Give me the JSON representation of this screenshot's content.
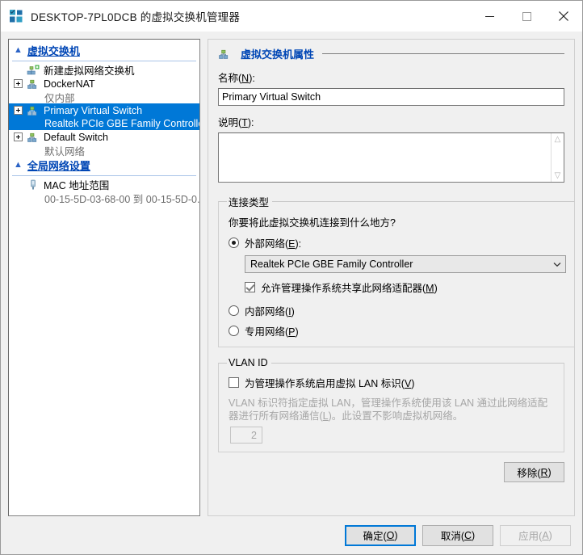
{
  "window": {
    "title": "DESKTOP-7PL0DCB 的虚拟交换机管理器",
    "app_icon": "hyperv-icon",
    "minimize_label": "—",
    "maximize_label": "□",
    "close_label": "✕"
  },
  "tree": {
    "sections": [
      {
        "label": "虚拟交换机",
        "items": [
          {
            "label": "新建虚拟网络交换机",
            "sub": "",
            "icon": "new-virtual-switch-icon",
            "expander": false,
            "selected": false
          },
          {
            "label": "DockerNAT",
            "sub": "仅内部",
            "icon": "virtual-switch-icon",
            "expander": true,
            "selected": false
          },
          {
            "label": "Primary Virtual Switch",
            "sub": "Realtek PCIe GBE Family Controller",
            "icon": "virtual-switch-icon",
            "expander": true,
            "selected": true
          },
          {
            "label": "Default Switch",
            "sub": "默认网络",
            "icon": "virtual-switch-icon",
            "expander": true,
            "selected": false
          }
        ]
      },
      {
        "label": "全局网络设置",
        "items": [
          {
            "label": "MAC 地址范围",
            "sub": "00-15-5D-03-68-00 到 00-15-5D-0...",
            "icon": "mac-address-icon",
            "expander": false,
            "selected": false
          }
        ]
      }
    ]
  },
  "detail": {
    "header": "虚拟交换机属性",
    "header_icon": "virtual-switch-icon",
    "name_label": "名称(N):",
    "name_value": "Primary Virtual Switch",
    "description_label": "说明(T):",
    "description_value": "",
    "connection": {
      "legend": "连接类型",
      "hint": "你要将此虚拟交换机连接到什么地方?",
      "external_label": "外部网络(E):",
      "external_selected": true,
      "adapter_value": "Realtek PCIe GBE Family Controller",
      "share_label": "允许管理操作系统共享此网络适配器(M)",
      "share_checked": true,
      "internal_label": "内部网络(I)",
      "internal_selected": false,
      "private_label": "专用网络(P)",
      "private_selected": false
    },
    "vlan": {
      "legend": "VLAN ID",
      "enable_label": "为管理操作系统启用虚拟 LAN 标识(V)",
      "enable_checked": false,
      "description": "VLAN 标识符指定虚拟 LAN，管理操作系统使用该 LAN 通过此网络适配器进行所有网络通信(L)。此设置不影响虚拟机网络。",
      "id_value": "2"
    },
    "remove_label": "移除(R)"
  },
  "footer": {
    "ok_label": "确定(O)",
    "cancel_label": "取消(C)",
    "apply_label": "应用(A)",
    "apply_disabled": true
  },
  "colors": {
    "selection": "#0078d7",
    "link": "#0046b5",
    "accent_border": "#0078d7"
  }
}
